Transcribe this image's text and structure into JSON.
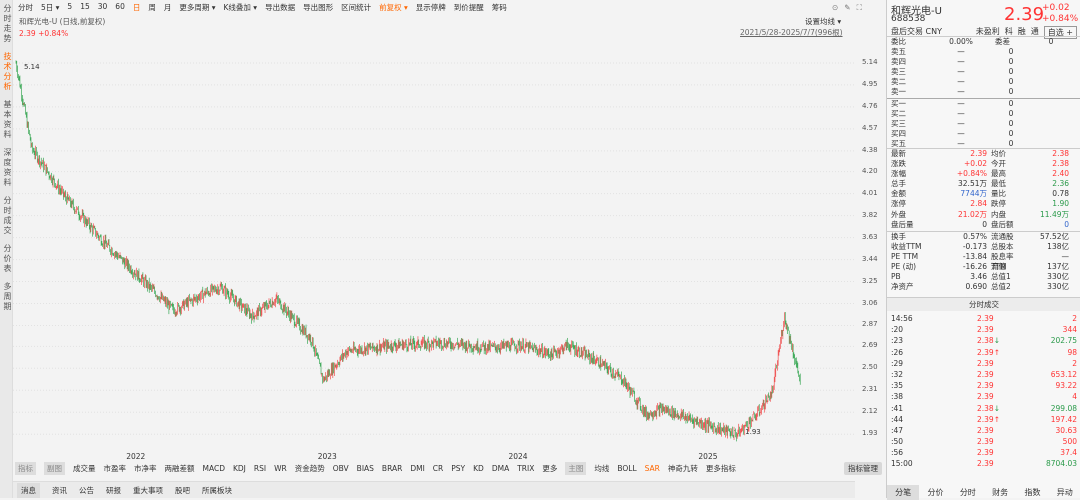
{
  "sidebar": [
    "分时走势",
    "技术分析",
    "基本资料",
    "深度资料",
    "分时成交",
    "分价表",
    "多周期"
  ],
  "toolbar": [
    "分时",
    "5日 ▾",
    "5",
    "15",
    "30",
    "60",
    "日",
    "周",
    "月",
    "更多周期 ▾",
    "K线叠加 ▾",
    "导出数据",
    "导出图形",
    "区间统计",
    "前复权 ▾",
    "显示停牌",
    "到价提醒",
    "筹码"
  ],
  "chart_header": {
    "title": "和辉光电-U (日线,前复权)",
    "quote": "2.39  +0.84%",
    "set_ma": "设置均线 ▾",
    "range": "2021/5/28-2025/7/7(996根)"
  },
  "chart_data": {
    "type": "candlestick",
    "y_ticks": [
      "5.14",
      "4.95",
      "4.76",
      "4.57",
      "4.38",
      "4.20",
      "4.01",
      "3.82",
      "3.63",
      "3.44",
      "3.25",
      "3.06",
      "2.87",
      "2.69",
      "2.50",
      "2.31",
      "2.12",
      "1.93"
    ],
    "ylim": [
      1.88,
      5.2
    ],
    "bars": 996,
    "x_labels": [
      {
        "label": "2022",
        "bar": 150
      },
      {
        "label": "2023",
        "bar": 393
      },
      {
        "label": "2024",
        "bar": 635
      },
      {
        "label": "2025",
        "bar": 876
      }
    ],
    "waypoints": [
      [
        0,
        5.14
      ],
      [
        20,
        4.4
      ],
      [
        60,
        4.0
      ],
      [
        110,
        3.6
      ],
      [
        170,
        3.2
      ],
      [
        200,
        3.0
      ],
      [
        240,
        3.15
      ],
      [
        260,
        3.2
      ],
      [
        300,
        2.95
      ],
      [
        330,
        3.1
      ],
      [
        355,
        2.9
      ],
      [
        375,
        2.75
      ],
      [
        390,
        2.4
      ],
      [
        420,
        2.65
      ],
      [
        480,
        2.7
      ],
      [
        540,
        2.72
      ],
      [
        600,
        2.68
      ],
      [
        640,
        2.7
      ],
      [
        680,
        2.62
      ],
      [
        700,
        2.7
      ],
      [
        740,
        2.55
      ],
      [
        770,
        2.4
      ],
      [
        800,
        2.1
      ],
      [
        820,
        2.15
      ],
      [
        860,
        2.05
      ],
      [
        890,
        1.98
      ],
      [
        915,
        1.93
      ],
      [
        940,
        2.1
      ],
      [
        960,
        2.3
      ],
      [
        975,
        2.95
      ],
      [
        995,
        2.39
      ]
    ],
    "max_label": "5.14",
    "min_label": "1.93"
  },
  "indicators": {
    "tag1": "指标",
    "tag2": "副图",
    "items": [
      "成交量",
      "市盈率",
      "市净率",
      "两融差额",
      "MACD",
      "KDJ",
      "RSI",
      "WR",
      "资金趋势",
      "OBV",
      "BIAS",
      "BRAR",
      "DMI",
      "CR",
      "PSY",
      "KD",
      "DMA",
      "TRIX",
      "更多"
    ],
    "main_tag": "主图",
    "main_items": [
      "均线",
      "BOLL",
      "SAR",
      "神奇九转",
      "更多指标"
    ],
    "manage": "指标管理"
  },
  "news_tabs": [
    "消息",
    "资讯",
    "公告",
    "研报",
    "重大事项",
    "股吧",
    "所属板块"
  ],
  "stock": {
    "name": "和辉光电-U",
    "code": "688538",
    "price": "2.39",
    "change": "+0.02",
    "pct": "+0.84%",
    "sub": [
      "盘后交易 CNY",
      "未盈利",
      "科",
      "融",
      "通",
      "自选 +"
    ]
  },
  "orderbook": {
    "weibi": [
      "委比",
      "0.00%",
      "委差",
      "0"
    ],
    "asks": [
      [
        "卖五",
        "—",
        "0"
      ],
      [
        "卖四",
        "—",
        "0"
      ],
      [
        "卖三",
        "—",
        "0"
      ],
      [
        "卖二",
        "—",
        "0"
      ],
      [
        "卖一",
        "—",
        "0"
      ]
    ],
    "bids": [
      [
        "买一",
        "—",
        "0"
      ],
      [
        "买二",
        "—",
        "0"
      ],
      [
        "买三",
        "—",
        "0"
      ],
      [
        "买四",
        "—",
        "0"
      ],
      [
        "买五",
        "—",
        "0"
      ]
    ]
  },
  "stats": [
    [
      "最新",
      "2.39",
      "均价",
      "2.38"
    ],
    [
      "涨跌",
      "+0.02",
      "今开",
      "2.38"
    ],
    [
      "涨幅",
      "+0.84%",
      "最高",
      "2.40"
    ],
    [
      "总手",
      "32.51万",
      "最低",
      "2.36"
    ],
    [
      "金额",
      "7744万",
      "量比",
      "0.78"
    ],
    [
      "涨停",
      "2.84",
      "跌停",
      "1.90"
    ],
    [
      "外盘",
      "21.02万",
      "内盘",
      "11.49万"
    ],
    [
      "盘后量",
      "0",
      "盘后额",
      "0"
    ]
  ],
  "fund": [
    [
      "换手",
      "0.57%",
      "流通股",
      "57.52亿"
    ],
    [
      "收益TTM",
      "-0.173",
      "总股本",
      "138亿"
    ],
    [
      "PE TTM",
      "-13.84",
      "股息率TTM",
      "—"
    ],
    [
      "PE (动)",
      "-16.26",
      "流值",
      "137亿"
    ],
    [
      "PB",
      "3.46",
      "总值1",
      "330亿"
    ],
    [
      "净资产",
      "0.690",
      "总值2",
      "330亿"
    ]
  ],
  "ticks_title": "分时成交",
  "ticks": [
    [
      "14:56",
      "2.39",
      "",
      "2"
    ],
    [
      ":20",
      "2.39",
      "",
      "344"
    ],
    [
      ":23",
      "2.38",
      "↓",
      "202.75"
    ],
    [
      ":26",
      "2.39",
      "↑",
      "98"
    ],
    [
      ":29",
      "2.39",
      "",
      "2"
    ],
    [
      ":32",
      "2.39",
      "",
      "653.12"
    ],
    [
      ":35",
      "2.39",
      "",
      "93.22"
    ],
    [
      ":38",
      "2.39",
      "",
      "4"
    ],
    [
      ":41",
      "2.38",
      "↓",
      "299.08"
    ],
    [
      ":44",
      "2.39",
      "↑",
      "197.42"
    ],
    [
      ":47",
      "2.39",
      "",
      "30.63"
    ],
    [
      ":50",
      "2.39",
      "",
      "500"
    ],
    [
      ":56",
      "2.39",
      "",
      "37.4"
    ],
    [
      "15:00",
      "2.39",
      "",
      "8704.03"
    ]
  ],
  "bottom_tabs": [
    "分笔",
    "分价",
    "分时",
    "财务",
    "指数",
    "异动"
  ]
}
